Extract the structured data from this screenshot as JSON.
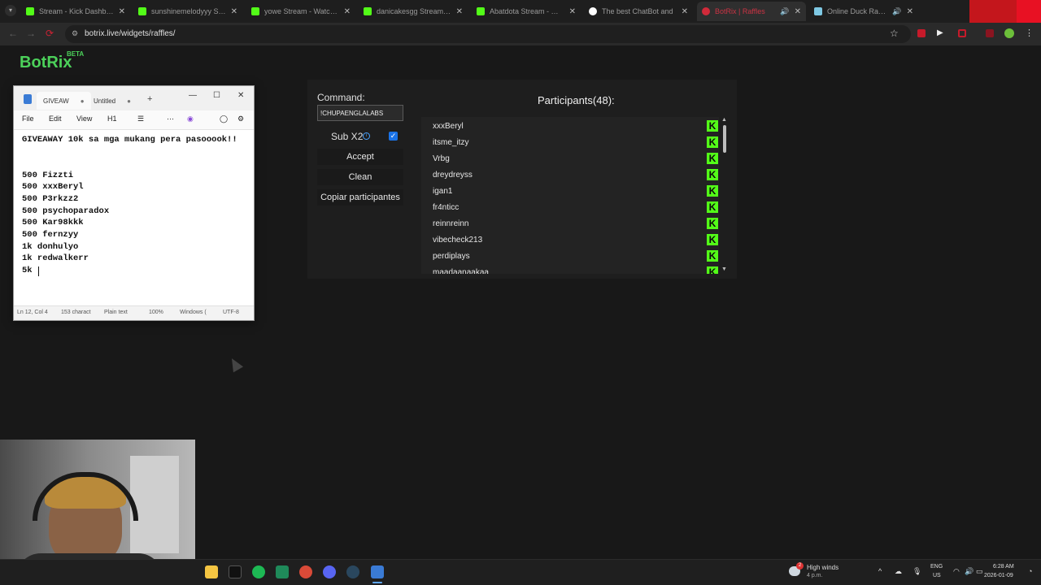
{
  "browser": {
    "tabs": [
      {
        "title": "Stream - Kick Dashboard",
        "favicon": "kick-icon",
        "active": false
      },
      {
        "title": "sunshinemelodyyy Stream",
        "favicon": "kick-icon",
        "active": false
      },
      {
        "title": "yowe Stream - Watch Liv",
        "favicon": "kick-icon",
        "active": false
      },
      {
        "title": "danicakesgg Stream - Wa",
        "favicon": "kick-icon",
        "active": false
      },
      {
        "title": "Abatdota Stream - Watch",
        "favicon": "kick-icon",
        "active": false
      },
      {
        "title": "The best ChatBot and",
        "favicon": "chatbot-icon",
        "active": false
      },
      {
        "title": "BotRix | Raffles",
        "favicon": "botrix-icon",
        "active": true
      },
      {
        "title": "Online Duck Race Na",
        "favicon": "duck-icon",
        "active": false
      }
    ],
    "url": "botrix.live/widgets/raffles/"
  },
  "brand": {
    "name": "BotRix",
    "badge": "BETA"
  },
  "raffle": {
    "command_label": "Command:",
    "command_value": "!CHUPAENGLALABS",
    "sub_label": "Sub X2",
    "sub_checked": true,
    "accept_label": "Accept",
    "clean_label": "Clean",
    "copy_label": "Copiar participantes",
    "participants_title": "Participants(48):",
    "participants": [
      "xxxBeryl",
      "itsme_itzy",
      "Vrbg",
      "dreydreyss",
      "igan1",
      "fr4nticc",
      "reinnreinn",
      "vibecheck213",
      "perdiplays",
      "maadaanaakaa"
    ]
  },
  "notepad": {
    "tabs": [
      "GIVEAW",
      "Untitled"
    ],
    "menu": [
      "File",
      "Edit",
      "View",
      "H1"
    ],
    "lines": [
      "GIVEAWAY 10k sa mga mukang pera pasooook!!",
      "",
      "",
      "500 Fizzti",
      "500 xxxBeryl",
      "500 P3rkzz2",
      "500 psychoparadox",
      "500 Kar98kkk",
      "500 fernzyy",
      "1k donhulyo",
      "1k redwalkerr",
      "5k "
    ],
    "status": {
      "position": "Ln 12, Col 4",
      "chars": "153 charact",
      "format": "Plain text",
      "zoom": "100%",
      "eol": "Windows (",
      "encoding": "UTF-8"
    }
  },
  "taskbar": {
    "weather_title": "High winds",
    "weather_sub": "4 p.m.",
    "weather_badge": "2",
    "lang": "ENG",
    "region": "US",
    "time": "6:28 AM",
    "date": "2026-01-09"
  }
}
